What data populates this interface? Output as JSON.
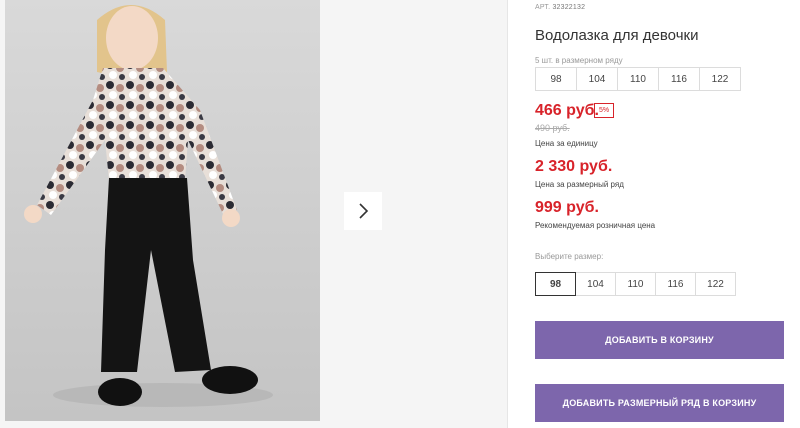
{
  "product": {
    "article_label": "АРТ.",
    "article_number": "32322132",
    "title": "Водолазка для девочки"
  },
  "size_row": {
    "hint": "5 шт. в размерном ряду",
    "sizes": [
      "98",
      "104",
      "110",
      "116",
      "122"
    ]
  },
  "pricing": {
    "unit_price": "466 руб.",
    "discount_badge": "5%",
    "old_price": "490 руб.",
    "unit_label": "Цена за единицу",
    "row_price": "2 330 руб.",
    "row_label": "Цена за размерный ряд",
    "retail_price": "999 руб.",
    "retail_label": "Рекомендуемая розничная цена"
  },
  "size_picker": {
    "label": "Выберите размер:",
    "sizes": [
      "98",
      "104",
      "110",
      "116",
      "122"
    ],
    "selected": "98"
  },
  "actions": {
    "add_to_cart": "ДОБАВИТЬ В КОРЗИНУ",
    "add_row_to_cart": "ДОБАВИТЬ РАЗМЕРНЫЙ РЯД В КОРЗИНУ"
  },
  "colors": {
    "accent": "#7d66ac",
    "price": "#d8232a"
  },
  "icons": {
    "next": "chevron-right-icon"
  }
}
